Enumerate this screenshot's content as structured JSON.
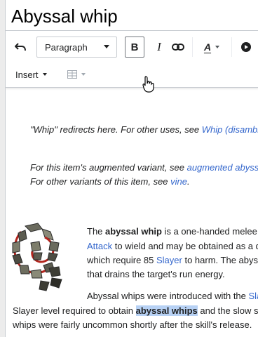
{
  "page": {
    "title": "Abyssal whip"
  },
  "toolbar": {
    "undo_icon": "undo-icon",
    "format_select": "Paragraph",
    "bold_label": "B",
    "italic_label": "I",
    "link_icon": "link-icon",
    "style_label": "A",
    "play_icon": "play-icon",
    "insert_label": "Insert",
    "table_icon": "table-icon"
  },
  "content": {
    "hatnote1": {
      "text": "\"Whip\" redirects here. For other uses, see ",
      "link": "Whip (disambig"
    },
    "hatnote2": {
      "text": "For this item's augmented variant, see ",
      "link": "augmented abyssa"
    },
    "hatnote3": {
      "text": "For other variants of this item, see ",
      "link": "vine",
      "end": "."
    },
    "image_name": "abyssal-whip-image",
    "para1": {
      "line1_a": "The ",
      "line1_b": "abyssal whip",
      "line1_c": " is a one-handed melee",
      "line2_link": "Attack",
      "line2_rest": " to wield and may be obtained as a d",
      "line3_a": "which require 85 ",
      "line3_link": "Slayer",
      "line3_b": " to harm. The abyss",
      "line4": "that drains the target's run energy."
    },
    "para2": {
      "line1_a": "Abyssal whips were introduced with the ",
      "line1_link": "Sla",
      "line2_a": "Slayer level required to obtain ",
      "line2_hl": "abyssal whips",
      "line2_b": " and the slow sp",
      "line3": "whips were fairly uncommon shortly after the skill's release."
    }
  },
  "colors": {
    "link": "#3366cc",
    "highlight": "#b7d1f4",
    "border": "#c8ccd1"
  }
}
